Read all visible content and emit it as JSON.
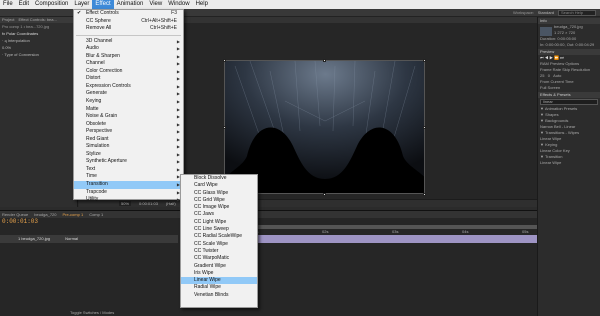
{
  "menubar": {
    "items": [
      "File",
      "Edit",
      "Composition",
      "Layer",
      "Effect",
      "Animation",
      "View",
      "Window",
      "Help"
    ],
    "active": "Effect"
  },
  "toolbar": {
    "workspace_label": "Workspace:",
    "workspace_value": "Standard",
    "search_placeholder": "Search Help"
  },
  "left_panel": {
    "tabs": [
      "Project",
      "Effect Controls: bea..."
    ],
    "subtitle": "Pro comp 1 • bea...720.jpg",
    "rows": [
      "fx  Polar Coordinates",
      "  · ą Interpolation",
      "     0.0%",
      "  · Type of Conversion"
    ]
  },
  "viewer": {
    "zoom": "50%",
    "status_items": [
      "50%",
      "0:00:01:03",
      "(Half)",
      "Active Camera",
      "1 View",
      "+0.0"
    ]
  },
  "right_panel": {
    "info_title": "Info",
    "file_name": "beudga_720.jpg",
    "file_size": "1 272 × 720",
    "duration": "Duration: 0:00:05:00",
    "in_out": "In: 0:00:00:00, Out: 0:00:04:29",
    "preview_title": "Preview",
    "ram_preview": "RAM Preview Options",
    "frame_rate_label": "Frame Rate",
    "skip_label": "Skip",
    "resolution_label": "Resolution",
    "frame_rate": "25",
    "skip": "0",
    "resolution": "Auto",
    "from_current": "From Current Time",
    "full_screen": "Full Screen",
    "effects_title": "Effects & Presets",
    "search_value": "linear",
    "tree": [
      "▼ Animation Presets",
      "   ▼ Shapes",
      "      ▼ Backgrounds",
      "          Narrow Bell - Linear",
      "   ▼ Transitions - Wipes",
      "          Linear Wipe",
      "▼ Keying",
      "      Linear Color Key",
      "▼ Transition",
      "      Linear Wipe"
    ]
  },
  "timeline": {
    "tabs": [
      "Render Queue",
      "beudga_720",
      "Pre-comp 1",
      "Comp 1"
    ],
    "active_tab": "Pre-comp 1",
    "timecode": "0:00:01:03",
    "layer_name": "1  beudga_720.jpg",
    "layer_mode": "Normal",
    "ruler": [
      "0:00s",
      "01s",
      "02s",
      "03s",
      "04s",
      "05s"
    ],
    "footer": "Toggle Switches / Modes"
  },
  "effect_menu": {
    "items": [
      {
        "label": "Effect Controls",
        "shortcut": "F3",
        "checked": true
      },
      {
        "label": "CC Sphere",
        "shortcut": "Ctrl+Alt+Shift+E"
      },
      {
        "label": "Remove All",
        "shortcut": "Ctrl+Shift+E"
      },
      {
        "separator": true
      },
      {
        "label": "3D Channel",
        "submenu": true
      },
      {
        "label": "Audio",
        "submenu": true
      },
      {
        "label": "Blur & Sharpen",
        "submenu": true
      },
      {
        "label": "Channel",
        "submenu": true
      },
      {
        "label": "Color Correction",
        "submenu": true
      },
      {
        "label": "Distort",
        "submenu": true
      },
      {
        "label": "Expression Controls",
        "submenu": true
      },
      {
        "label": "Generate",
        "submenu": true
      },
      {
        "label": "Keying",
        "submenu": true
      },
      {
        "label": "Matte",
        "submenu": true
      },
      {
        "label": "Noise & Grain",
        "submenu": true
      },
      {
        "label": "Obsolete",
        "submenu": true
      },
      {
        "label": "Perspective",
        "submenu": true
      },
      {
        "label": "Red Giant",
        "submenu": true
      },
      {
        "label": "Simulation",
        "submenu": true
      },
      {
        "label": "Stylize",
        "submenu": true
      },
      {
        "label": "Synthetic Aperture",
        "submenu": true
      },
      {
        "label": "Text",
        "submenu": true
      },
      {
        "label": "Time",
        "submenu": true
      },
      {
        "label": "Transition",
        "submenu": true,
        "highlighted": true
      },
      {
        "label": "Trapcode",
        "submenu": true
      },
      {
        "label": "Utility",
        "submenu": true
      }
    ]
  },
  "transition_submenu": {
    "items": [
      "Block Dissolve",
      "Card Wipe",
      "CC Glass Wipe",
      "CC Grid Wipe",
      "CC Image Wipe",
      "CC Jaws",
      "CC Light Wipe",
      "CC Line Sweep",
      "CC Radial ScaleWipe",
      "CC Scale Wipe",
      "CC Twister",
      "CC WarpoMatic",
      "Gradient Wipe",
      "Iris Wipe",
      "Linear Wipe",
      "Radial Wipe",
      "Venetian Blinds"
    ],
    "highlighted": "Linear Wipe"
  }
}
